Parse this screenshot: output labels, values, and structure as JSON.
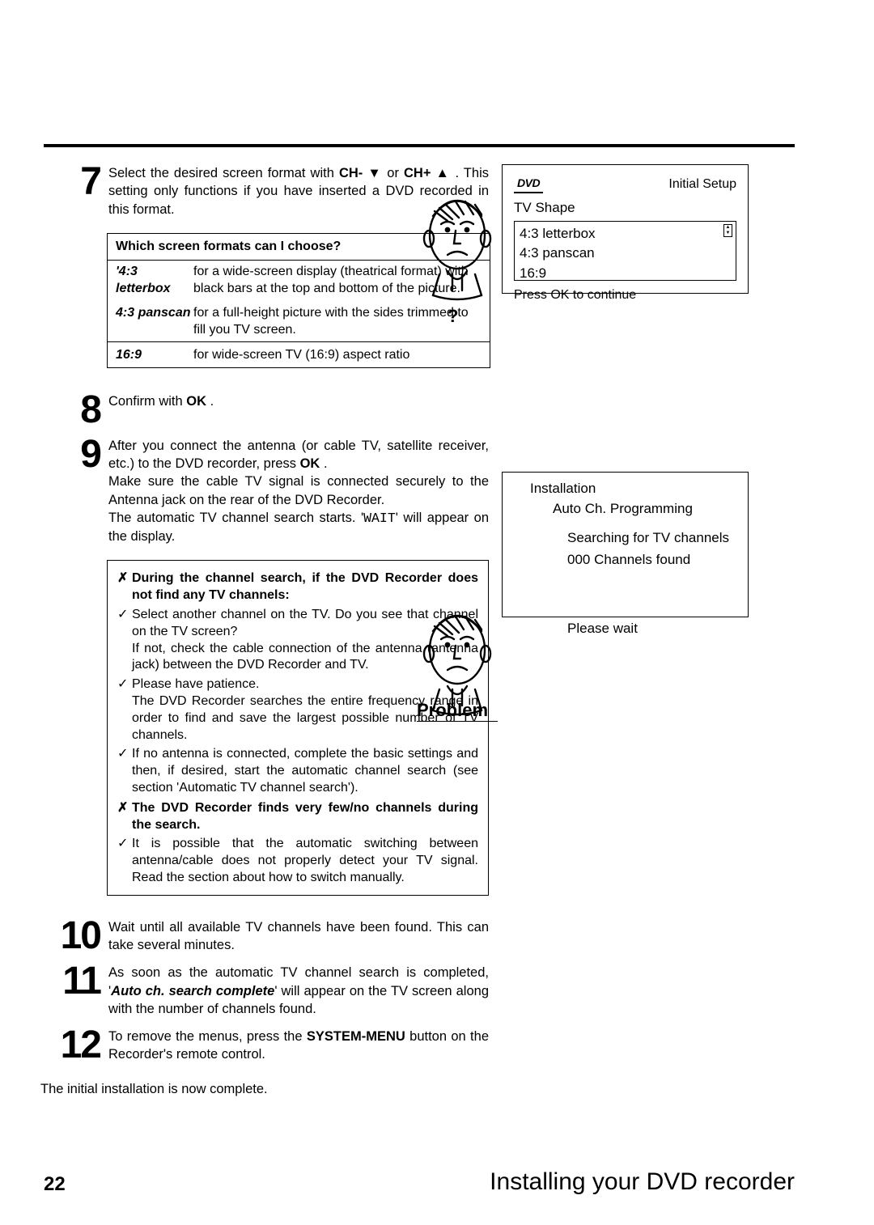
{
  "steps": {
    "s7": {
      "num": "7",
      "text_a": "Select the desired screen format with ",
      "btn_down": "CH-",
      "text_or": " or ",
      "btn_up": "CH+",
      "text_b": " . This setting only functions if you have inserted a DVD recorded in this format."
    },
    "s8": {
      "num": "8",
      "text_a": "Confirm with ",
      "btn": "OK",
      "text_b": " ."
    },
    "s9": {
      "num": "9",
      "p1_a": "After you connect the antenna (or cable TV, satellite receiver, etc.) to the DVD recorder, press ",
      "p1_btn": "OK",
      "p1_b": " .",
      "p2": "Make sure the cable TV signal is connected securely to the Antenna jack on the rear of the DVD Recorder.",
      "p3_a": "The automatic TV channel search starts. '",
      "p3_lcd": "WAIT",
      "p3_b": "' will appear on the display."
    },
    "s10": {
      "num": "10",
      "text": "Wait until all available TV channels have been found. This can take several minutes."
    },
    "s11": {
      "num": "11",
      "text_a": "As soon as the automatic TV channel search is completed, '",
      "bold": "Auto ch. search complete",
      "text_b": "' will appear on the TV screen along with the number of channels found."
    },
    "s12": {
      "num": "12",
      "text_a": "To remove the menus, press the ",
      "btn": "SYSTEM-MENU",
      "text_b": " button on the Recorder's remote control."
    }
  },
  "formats": {
    "head": "Which screen formats can I choose?",
    "rows": [
      {
        "k": "'4:3 letterbox",
        "v": "for a wide-screen display (theatrical format) with black bars at the top and bottom of the picture."
      },
      {
        "k": "4:3 panscan",
        "v": "for a full-height picture with the sides trimmed to fill you TV screen."
      },
      {
        "k": "16:9",
        "v": "for wide-screen TV (16:9) aspect ratio"
      }
    ]
  },
  "problem": {
    "x1": "During the channel search, if the DVD Recorder does not find any TV channels:",
    "c1": "Select another channel on the TV. Do you see that channel on the TV screen?",
    "c1b": "If not, check the cable connection of the antenna (antenna jack) between the DVD Recorder and TV.",
    "c2": "Please have patience.",
    "c2b": "The DVD Recorder searches the entire frequency range in order to find and save the largest possible number of TV channels.",
    "c3": "If no antenna is connected, complete the basic settings and then, if desired, start the automatic channel search (see section 'Automatic TV channel search').",
    "x2": "The DVD Recorder finds very few/no channels during the search.",
    "c4": "It is possible that the automatic switching between antenna/cable does not properly detect your TV signal. Read the section about how to switch manually."
  },
  "closing": "The initial installation is now complete.",
  "face": {
    "q": "?",
    "problem": "Problem"
  },
  "osd1": {
    "logo": "DVD",
    "title": "Initial Setup",
    "section": "TV Shape",
    "opt1": "4:3 letterbox",
    "opt2": "4:3 panscan",
    "opt3": "16:9",
    "footer": "Press OK to continue"
  },
  "osd2": {
    "l1": "Installation",
    "l2": "Auto Ch. Programming",
    "l3": "Searching for TV channels",
    "l4": "000 Channels found",
    "l5": "Please wait"
  },
  "footer": {
    "page": "22",
    "chapter": "Installing your DVD recorder"
  }
}
